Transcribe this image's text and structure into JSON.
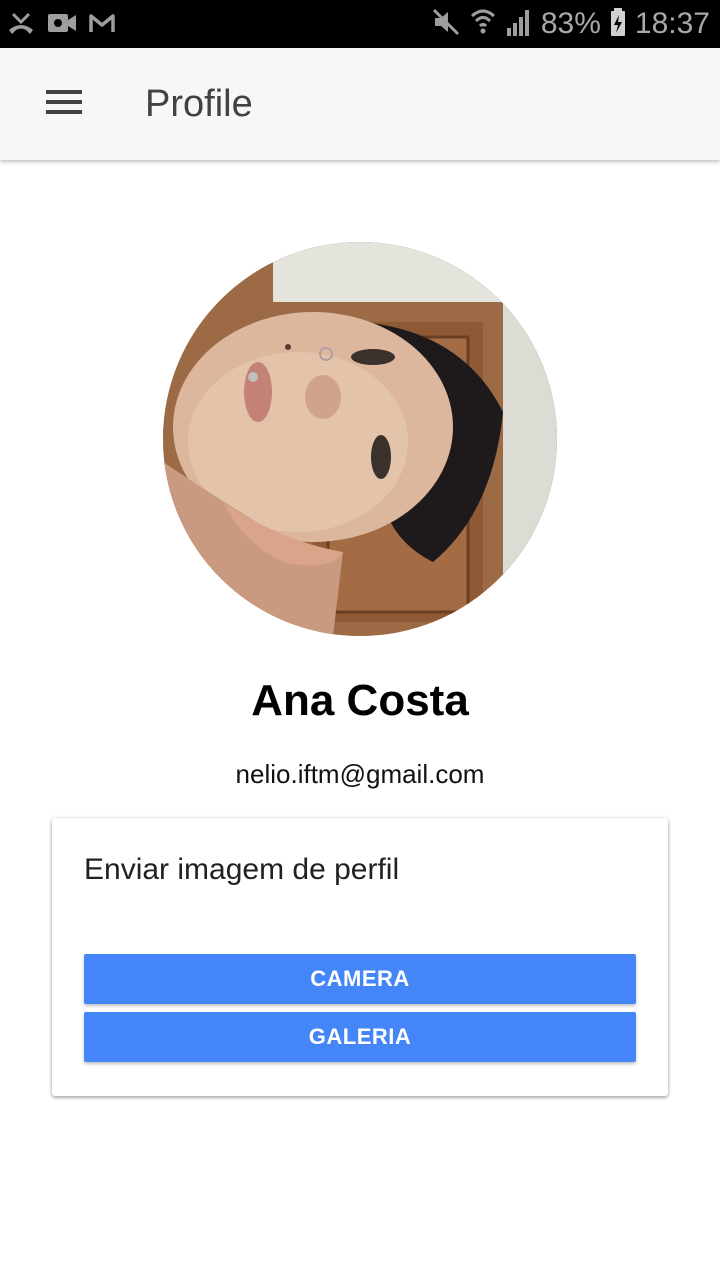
{
  "status_bar": {
    "battery_percent": "83%",
    "time": "18:37",
    "left_icons": [
      "missed-call-icon",
      "video-icon",
      "gmail-icon"
    ],
    "right_icons": [
      "mute-icon",
      "wifi-icon",
      "signal-icon",
      "battery-charging-icon"
    ]
  },
  "app_bar": {
    "title": "Profile",
    "menu_icon": "hamburger-menu-icon"
  },
  "profile": {
    "name": "Ana Costa",
    "email": "nelio.iftm@gmail.com"
  },
  "upload_card": {
    "title": "Enviar imagem de perfil",
    "camera_label": "CAMERA",
    "gallery_label": "GALERIA"
  },
  "colors": {
    "primary_button": "#4486f7",
    "app_bar_bg": "#f7f7f7",
    "status_bar_bg": "#000000"
  }
}
